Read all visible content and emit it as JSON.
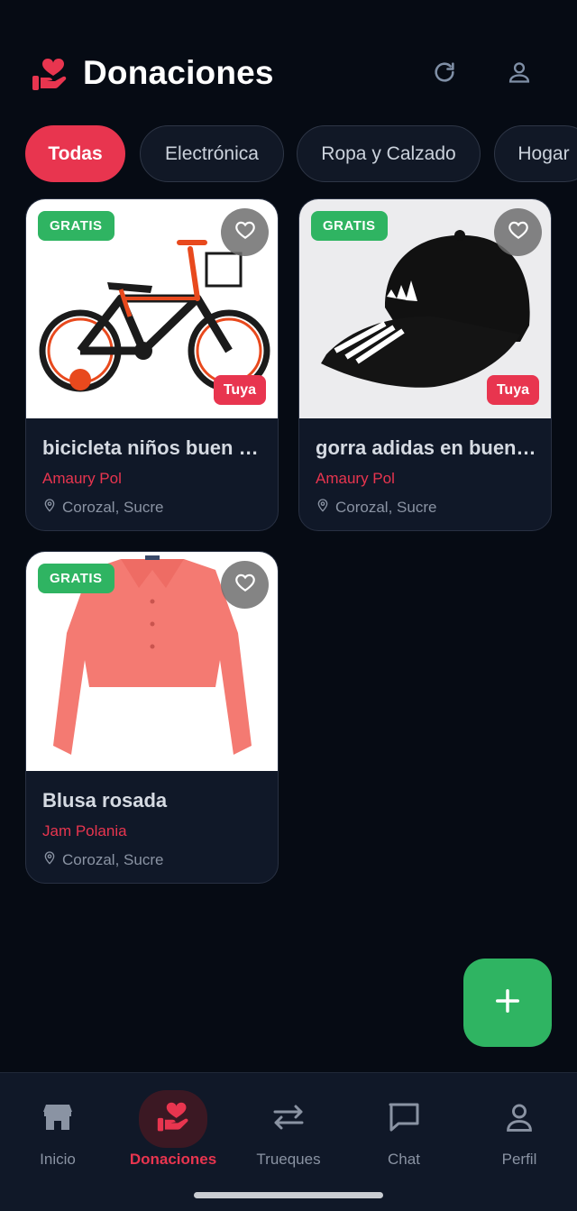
{
  "header": {
    "title": "Donaciones",
    "logo_icon": "hand-heart-icon",
    "refresh_icon": "refresh-icon",
    "profile_icon": "user-icon"
  },
  "filters": [
    {
      "label": "Todas",
      "active": true
    },
    {
      "label": "Electrónica",
      "active": false
    },
    {
      "label": "Ropa y Calzado",
      "active": false
    },
    {
      "label": "Hogar",
      "active": false
    }
  ],
  "items": [
    {
      "title": "bicicleta niños buen estado",
      "owner": "Amaury Pol",
      "location": "Corozal, Sucre",
      "badge": "GRATIS",
      "mine": "Tuya"
    },
    {
      "title": "gorra adidas en buen estado",
      "owner": "Amaury Pol",
      "location": "Corozal, Sucre",
      "badge": "GRATIS",
      "mine": "Tuya"
    },
    {
      "title": "Blusa rosada",
      "owner": "Jam Polania",
      "location": "Corozal, Sucre",
      "badge": "GRATIS"
    }
  ],
  "fab": {
    "icon": "plus-icon"
  },
  "nav": [
    {
      "label": "Inicio",
      "icon": "store-icon",
      "active": false
    },
    {
      "label": "Donaciones",
      "icon": "hand-heart-icon",
      "active": true
    },
    {
      "label": "Trueques",
      "icon": "swap-arrows-icon",
      "active": false
    },
    {
      "label": "Chat",
      "icon": "chat-bubble-icon",
      "active": false
    },
    {
      "label": "Perfil",
      "icon": "user-icon",
      "active": false
    }
  ],
  "colors": {
    "accent": "#e8354f",
    "success": "#2fb462",
    "background": "#060b14",
    "card": "#101828"
  }
}
